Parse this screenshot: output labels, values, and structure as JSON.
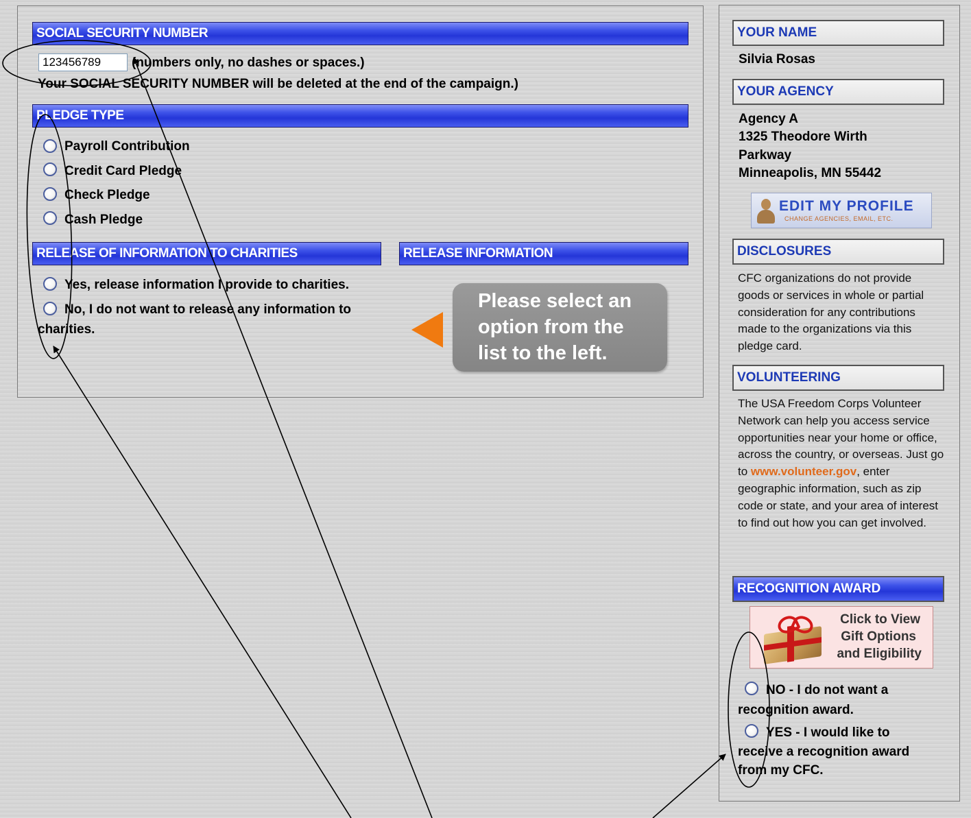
{
  "ssn": {
    "header": "SOCIAL SECURITY NUMBER",
    "value": "123456789",
    "hint": "(numbers only, no dashes or spaces.)",
    "note": "Your SOCIAL SECURITY NUMBER will be deleted at the end of the campaign.)"
  },
  "pledge_type": {
    "header": "PLEDGE TYPE",
    "options": [
      "Payroll Contribution",
      "Credit Card Pledge",
      "Check Pledge",
      "Cash Pledge"
    ]
  },
  "release": {
    "header": "RELEASE OF INFORMATION TO CHARITIES",
    "options": [
      "Yes, release information I provide to charities.",
      "No, I do not want to release any information to",
      "charities."
    ]
  },
  "release_info": {
    "header": "RELEASE INFORMATION",
    "callout_lines": [
      "Please select an",
      "option from the",
      "list to the left."
    ]
  },
  "sidebar": {
    "your_name_header": "YOUR NAME",
    "name": "Silvia Rosas",
    "your_agency_header": "YOUR AGENCY",
    "agency_lines": [
      "Agency A",
      "1325 Theodore Wirth",
      "Parkway",
      "Minneapolis, MN 55442"
    ],
    "edit_profile": {
      "title": "EDIT MY PROFILE",
      "subtitle": "CHANGE AGENCIES, EMAIL, ETC."
    },
    "disclosures_header": "DISCLOSURES",
    "disclosures_text": "CFC organizations do not provide goods or services in whole or partial consideration for any contributions made to the organizations via this pledge card.",
    "volunteering_header": "VOLUNTEERING",
    "volunteering_before": "The USA Freedom Corps Volunteer Network can help you access service opportunities near your home or office, across the country, or overseas. Just go to ",
    "volunteering_link": "www.volunteer.gov",
    "volunteering_after": ", enter geographic information, such as zip code or state, and your area of interest to find out how you can get involved.",
    "recognition_header": "RECOGNITION AWARD",
    "gift_lines": [
      "Click to View",
      "Gift Options",
      "and Eligibility"
    ],
    "recognition_options": {
      "no_line1": "NO - I do not want a",
      "no_line2": "recognition award.",
      "yes_line1": "YES - I would like to",
      "yes_line2": "receive a recognition award",
      "yes_line3": "from my CFC."
    }
  },
  "colors": {
    "bar_blue": "#2f44e0",
    "sidebar_header_text": "#1d3ab5",
    "link_orange": "#e06a1b",
    "callout_gray": "#8e8e8e",
    "arrow_orange": "#f07a10"
  }
}
